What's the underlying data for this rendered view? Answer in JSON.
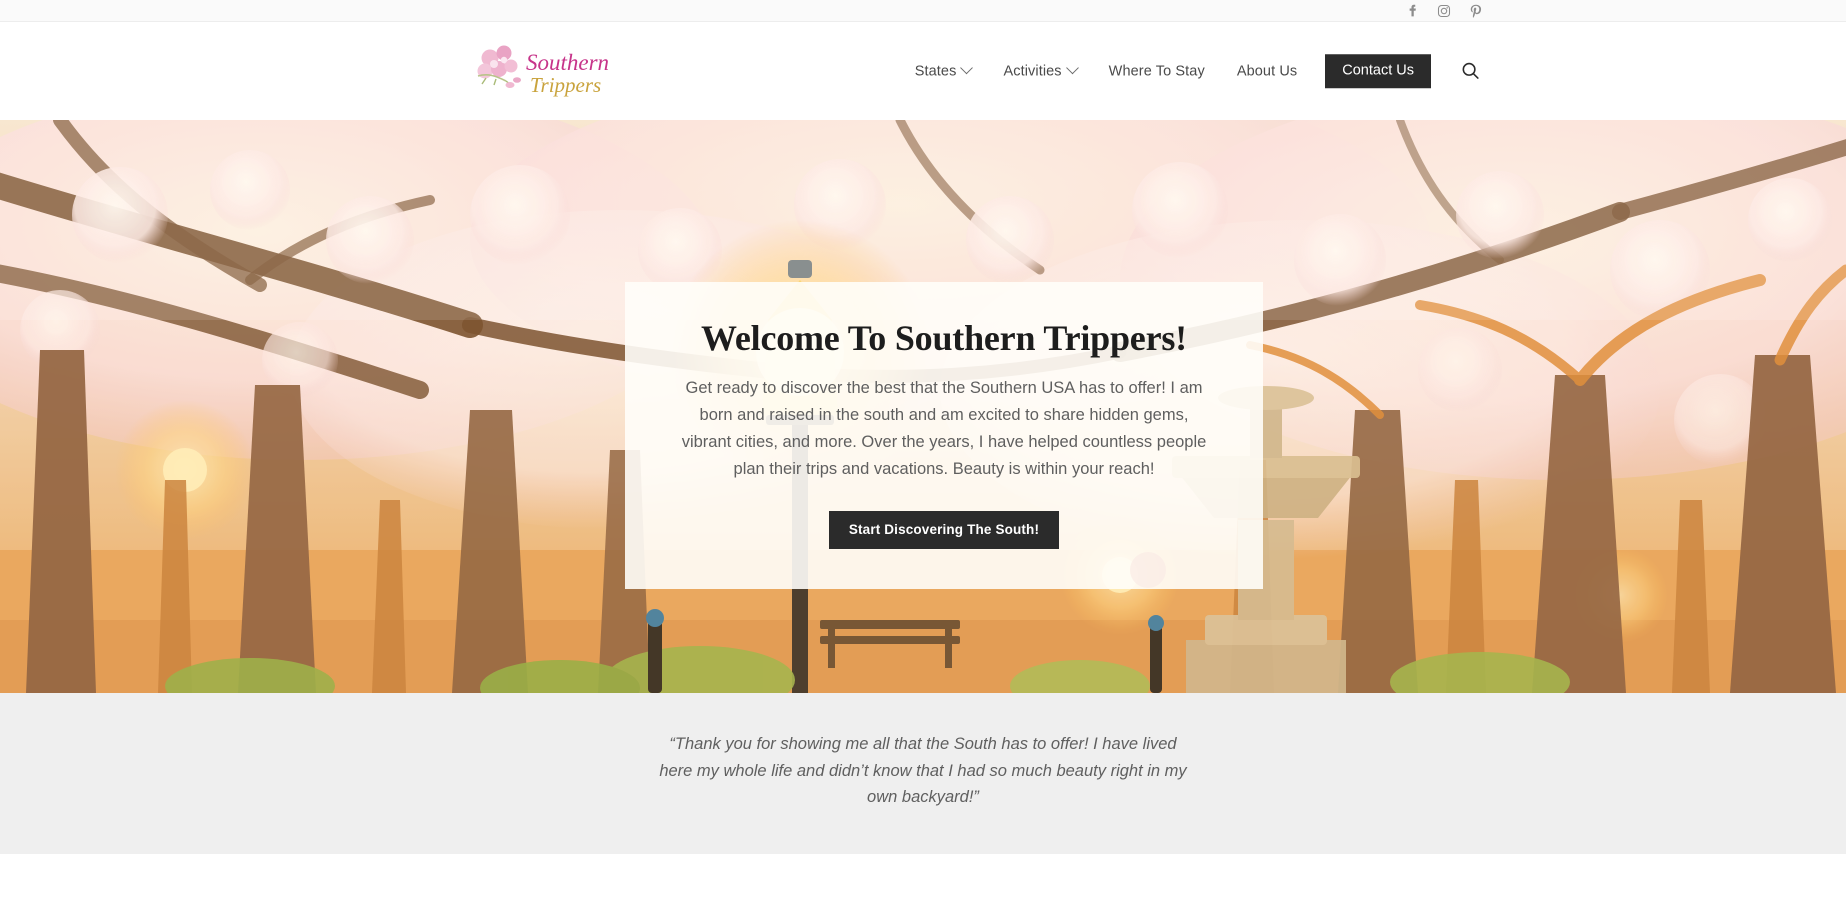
{
  "topbar": {
    "social": [
      {
        "name": "facebook-icon",
        "label": "Facebook"
      },
      {
        "name": "instagram-icon",
        "label": "Instagram"
      },
      {
        "name": "pinterest-icon",
        "label": "Pinterest"
      }
    ]
  },
  "header": {
    "logo": {
      "line1": "Southern",
      "line2": "Trippers",
      "alt": "Southern Trippers logo",
      "color_line1": "#c7348a",
      "color_line2": "#c9a33d",
      "blossom_color": "#e9a8c6"
    },
    "nav": [
      {
        "label": "States",
        "has_dropdown": true
      },
      {
        "label": "Activities",
        "has_dropdown": true
      },
      {
        "label": "Where To Stay",
        "has_dropdown": false
      },
      {
        "label": "About Us",
        "has_dropdown": false
      }
    ],
    "cta_label": "Contact Us",
    "search_label": "Search"
  },
  "hero": {
    "title": "Welcome To Southern Trippers!",
    "paragraph": "Get ready to discover the best that the Southern USA has to offer! I am born and raised in the south and am excited to share hidden gems, vibrant cities, and more. Over the years, I have helped countless people plan their trips and vacations. Beauty is within your reach!",
    "button_label": "Start Discovering The South!",
    "image_alt": "Street lined with blooming cherry blossom trees at golden hour with a glowing lantern and stone fountain"
  },
  "testimonial": {
    "quote": "“Thank you for showing me all that the South has to offer! I have lived here my whole life and didn’t know that I had so much beauty right in my own backyard!”"
  },
  "colors": {
    "dark": "#2b2b2b",
    "body_text": "#5f5f5f",
    "topbar_bg": "#fafafa",
    "testimonial_bg": "#efefef",
    "card_bg": "rgba(255,254,250,0.90)"
  }
}
